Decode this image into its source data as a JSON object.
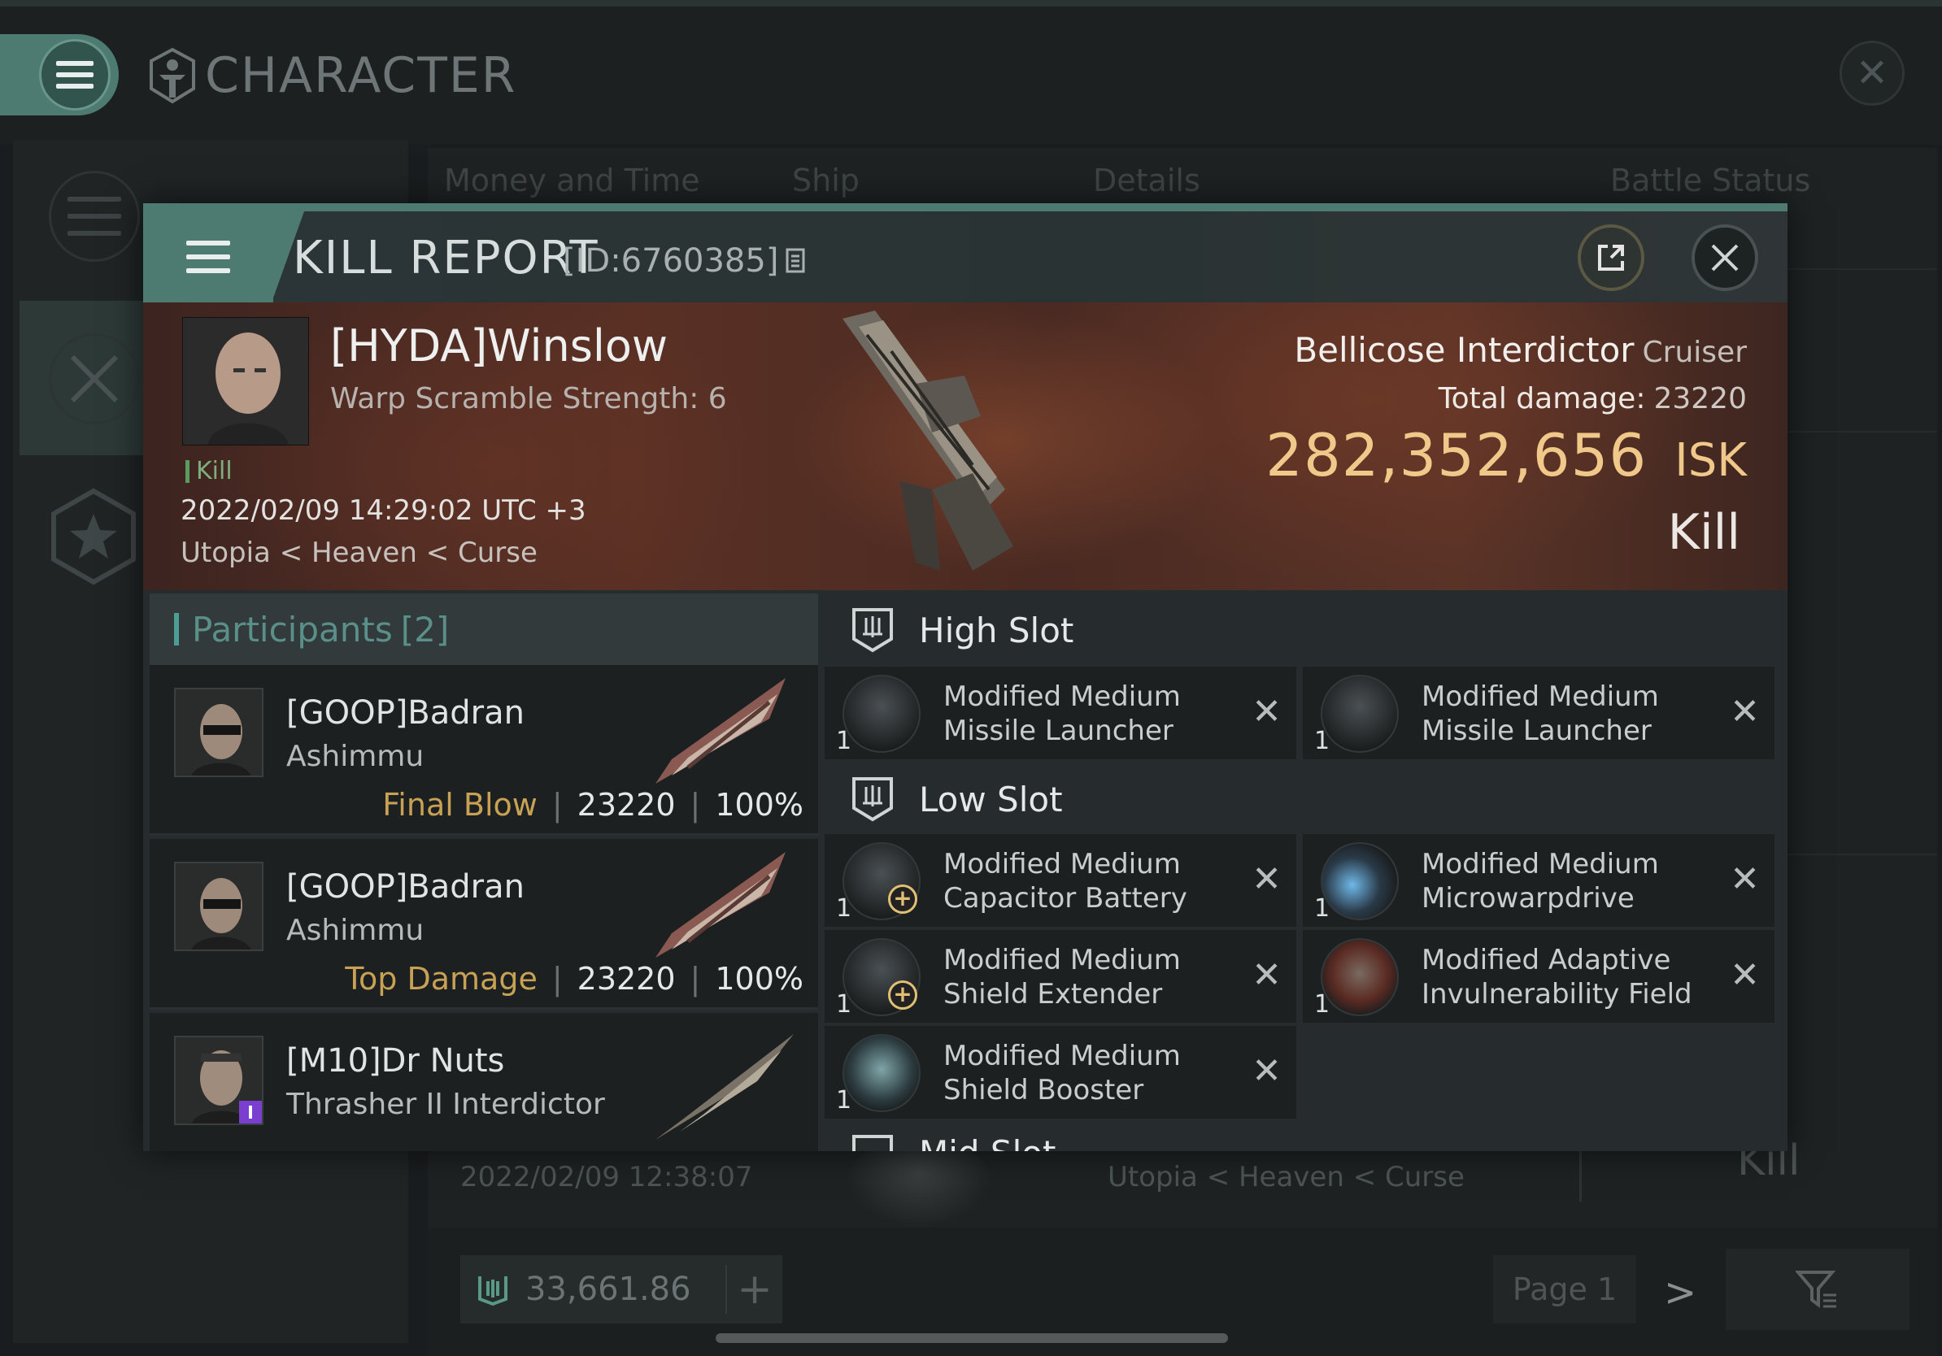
{
  "app": {
    "title": "CHARACTER",
    "tabs": [
      "Money and Time",
      "Ship",
      "Details",
      "Battle Status"
    ],
    "bg_row": {
      "date": "2022/02/09  12:38:07",
      "location": "Utopia < Heaven < Curse",
      "result": "Kill"
    },
    "isk_balance": "33,661.86",
    "page_label": "Page 1"
  },
  "modal": {
    "title": "KILL REPORT",
    "report_id": "[ID:6760385]",
    "victim": {
      "name": "[HYDA]Winslow",
      "warp_scramble": "Warp Scramble Strength: 6",
      "kill_tag": "Kill",
      "datetime": "2022/02/09 14:29:02 UTC +3",
      "location": "Utopia < Heaven < Curse"
    },
    "ship": {
      "name": "Bellicose Interdictor",
      "class": "Cruiser",
      "total_damage_label": "Total damage:",
      "total_damage": "23220",
      "isk_value": "282,352,656",
      "isk_unit": "ISK",
      "result": "Kill"
    },
    "participants": {
      "label": "Participants",
      "count": "[2]",
      "rows": [
        {
          "name": "[GOOP]Badran",
          "ship": "Ashimmu",
          "role": "Final Blow",
          "damage": "23220",
          "percent": "100%"
        },
        {
          "name": "[GOOP]Badran",
          "ship": "Ashimmu",
          "role": "Top Damage",
          "damage": "23220",
          "percent": "100%"
        },
        {
          "name": "[M10]Dr Nuts",
          "ship": "Thrasher II Interdictor",
          "role": "",
          "damage": "",
          "percent": ""
        }
      ]
    },
    "slots": {
      "high_label": "High Slot",
      "low_label": "Low Slot",
      "mid_label": "Mid Slot",
      "high": [
        {
          "name": "Modified Medium Missile Launcher",
          "qty": "1"
        },
        {
          "name": "Modified Medium Missile Launcher",
          "qty": "1"
        }
      ],
      "low": [
        {
          "name": "Modified Medium Capacitor Battery",
          "qty": "1"
        },
        {
          "name": "Modified Medium Microwarpdrive",
          "qty": "1"
        },
        {
          "name": "Modified Medium Shield Extender",
          "qty": "1"
        },
        {
          "name": "Modified Adaptive Invulnerability Field",
          "qty": "1"
        },
        {
          "name": "Modified Medium Shield Booster",
          "qty": "1"
        }
      ]
    },
    "colors": {
      "accent": "#4d7b72",
      "isk": "#f0c88a",
      "final_blow": "#c8a154",
      "kill_green": "#7fae7d"
    }
  }
}
